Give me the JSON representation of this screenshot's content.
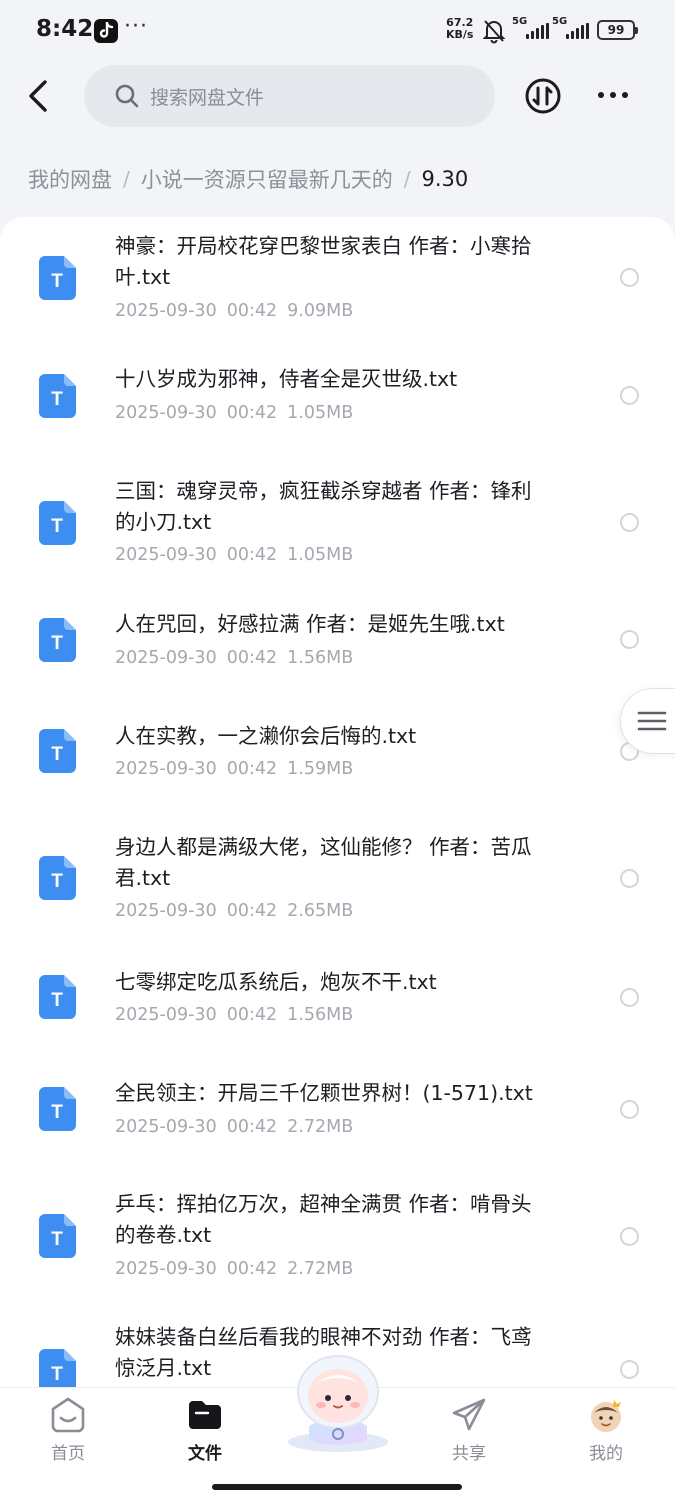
{
  "status_bar": {
    "time": "8:42",
    "dots": "···",
    "net_speed_value": "67.2",
    "net_speed_unit": "KB/s",
    "signal_1": "5G",
    "signal_2": "5G",
    "battery": "99"
  },
  "header": {
    "search_placeholder": "搜索网盘文件"
  },
  "breadcrumb": {
    "items": [
      "我的网盘",
      "小说一资源只留最新几天的",
      "9.30"
    ],
    "separator": "/"
  },
  "files": [
    {
      "name_line1": "神豪：开局校花穿巴黎世家表白 作者：小寒拾",
      "name_line2": "叶.txt",
      "date": "2025-09-30",
      "time": "00:42",
      "size": "9.09MB"
    },
    {
      "name_line1": "十八岁成为邪神，侍者全是灭世级.txt",
      "name_line2": "",
      "date": "2025-09-30",
      "time": "00:42",
      "size": "1.05MB"
    },
    {
      "name_line1": "三国：魂穿灵帝，疯狂截杀穿越者 作者：锋利",
      "name_line2": "的小刀.txt",
      "date": "2025-09-30",
      "time": "00:42",
      "size": "1.05MB"
    },
    {
      "name_line1": "人在咒回，好感拉满 作者：是姬先生哦.txt",
      "name_line2": "",
      "date": "2025-09-30",
      "time": "00:42",
      "size": "1.56MB"
    },
    {
      "name_line1": "人在实教，一之濑你会后悔的.txt",
      "name_line2": "",
      "date": "2025-09-30",
      "time": "00:42",
      "size": "1.59MB"
    },
    {
      "name_line1": "身边人都是满级大佬，这仙能修？ 作者：苦瓜",
      "name_line2": "君.txt",
      "date": "2025-09-30",
      "time": "00:42",
      "size": "2.65MB"
    },
    {
      "name_line1": "七零绑定吃瓜系统后，炮灰不干.txt",
      "name_line2": "",
      "date": "2025-09-30",
      "time": "00:42",
      "size": "1.56MB"
    },
    {
      "name_line1": "全民领主：开局三千亿颗世界树！(1-571).txt",
      "name_line2": "",
      "date": "2025-09-30",
      "time": "00:42",
      "size": "2.72MB"
    },
    {
      "name_line1": "乒乓：挥拍亿万次，超神全满贯 作者：啃骨头",
      "name_line2": "的卷卷.txt",
      "date": "2025-09-30",
      "time": "00:42",
      "size": "2.72MB"
    },
    {
      "name_line1": "妹妹装备白丝后看我的眼神不对劲 作者：飞鸢",
      "name_line2": "惊泛月.txt",
      "date": "",
      "time": "",
      "size": ""
    }
  ],
  "file_icon_letter": "T",
  "bottom_nav": {
    "home": "首页",
    "files": "文件",
    "share": "共享",
    "mine": "我的"
  },
  "colors": {
    "file_icon_blue": "#3d8ef0",
    "page_bg": "#f3f4f8",
    "meta_gray": "#a6a8b0"
  }
}
